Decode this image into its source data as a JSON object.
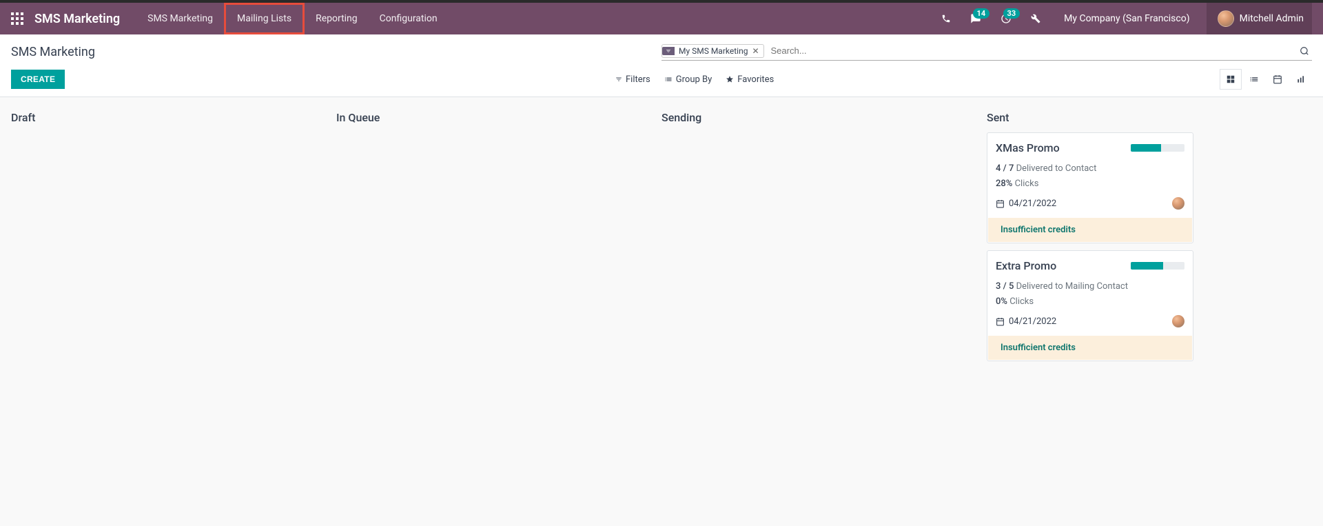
{
  "app": {
    "title": "SMS Marketing"
  },
  "nav": {
    "items": [
      {
        "label": "SMS Marketing"
      },
      {
        "label": "Mailing Lists"
      },
      {
        "label": "Reporting"
      },
      {
        "label": "Configuration"
      }
    ]
  },
  "systray": {
    "messages_count": "14",
    "activities_count": "33"
  },
  "company": {
    "name": "My Company (San Francisco)"
  },
  "user": {
    "name": "Mitchell Admin"
  },
  "breadcrumb": {
    "title": "SMS Marketing"
  },
  "search": {
    "chip_label": "My SMS Marketing",
    "placeholder": "Search..."
  },
  "buttons": {
    "create": "CREATE"
  },
  "search_options": {
    "filters": "Filters",
    "group_by": "Group By",
    "favorites": "Favorites"
  },
  "columns": [
    {
      "title": "Draft"
    },
    {
      "title": "In Queue"
    },
    {
      "title": "Sending"
    },
    {
      "title": "Sent"
    }
  ],
  "cards": [
    {
      "title": "XMas Promo",
      "progress_pct": 57,
      "delivered_num": "4",
      "delivered_total": "7",
      "delivered_label": "Delivered to Contact",
      "clicks_pct": "28%",
      "clicks_label": "Clicks",
      "date": "04/21/2022",
      "warning": "Insufficient credits"
    },
    {
      "title": "Extra Promo",
      "progress_pct": 60,
      "delivered_num": "3",
      "delivered_total": "5",
      "delivered_label": "Delivered to Mailing Contact",
      "clicks_pct": "0%",
      "clicks_label": "Clicks",
      "date": "04/21/2022",
      "warning": "Insufficient credits"
    }
  ]
}
